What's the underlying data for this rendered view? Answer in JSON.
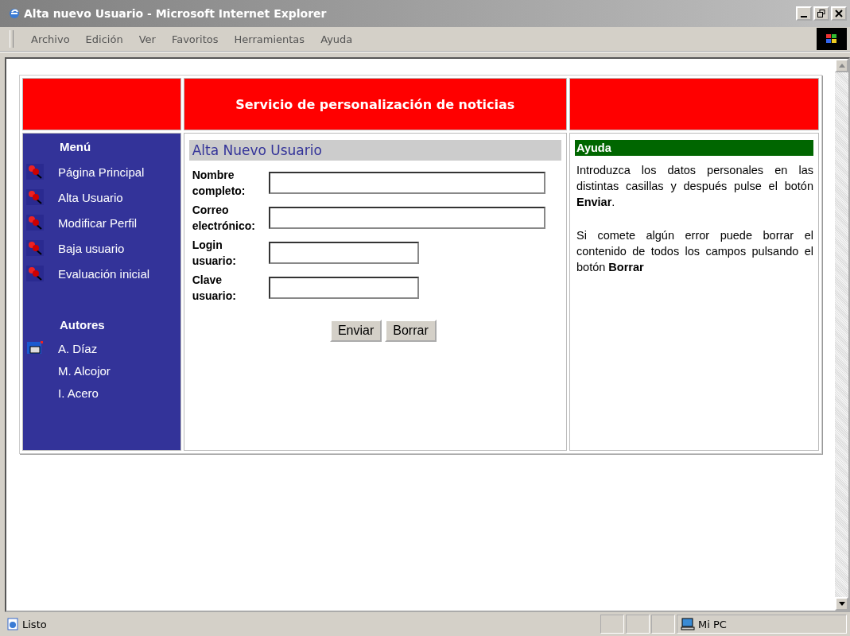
{
  "window": {
    "title": "Alta nuevo Usuario - Microsoft Internet Explorer"
  },
  "menu_bar": [
    "Archivo",
    "Edición",
    "Ver",
    "Favoritos",
    "Herramientas",
    "Ayuda"
  ],
  "header": {
    "title": "Servicio de personalización de noticias"
  },
  "sidebar": {
    "menu_title": "Menú",
    "menu_items": [
      {
        "label": "Página Principal"
      },
      {
        "label": "Alta Usuario"
      },
      {
        "label": "Modificar Perfil"
      },
      {
        "label": "Baja usuario"
      },
      {
        "label": "Evaluación inicial"
      }
    ],
    "authors_title": "Autores",
    "authors": [
      {
        "name": "A. Díaz",
        "kind": "mail"
      },
      {
        "name": "M. Alcojor",
        "kind": "plain"
      },
      {
        "name": "I. Acero",
        "kind": "plain"
      }
    ]
  },
  "form": {
    "title": "Alta Nuevo Usuario",
    "fields": [
      {
        "label": "Nombre completo:",
        "kind": "long"
      },
      {
        "label": "Correo electrónico:",
        "kind": "long"
      },
      {
        "label": "Login usuario:",
        "kind": "short"
      },
      {
        "label": "Clave usuario:",
        "kind": "short"
      }
    ],
    "buttons": [
      "Enviar",
      "Borrar"
    ]
  },
  "help": {
    "title": "Ayuda",
    "paragraphs": [
      "Introduzca los datos personales en las distintas casillas y después pulse el botón **Enviar**.",
      "Si comete algún error puede borrar el contenido de todos los campos pulsando el botón **Borrar**"
    ]
  },
  "status_bar": {
    "text": "Listo",
    "zone": "Mi PC"
  }
}
